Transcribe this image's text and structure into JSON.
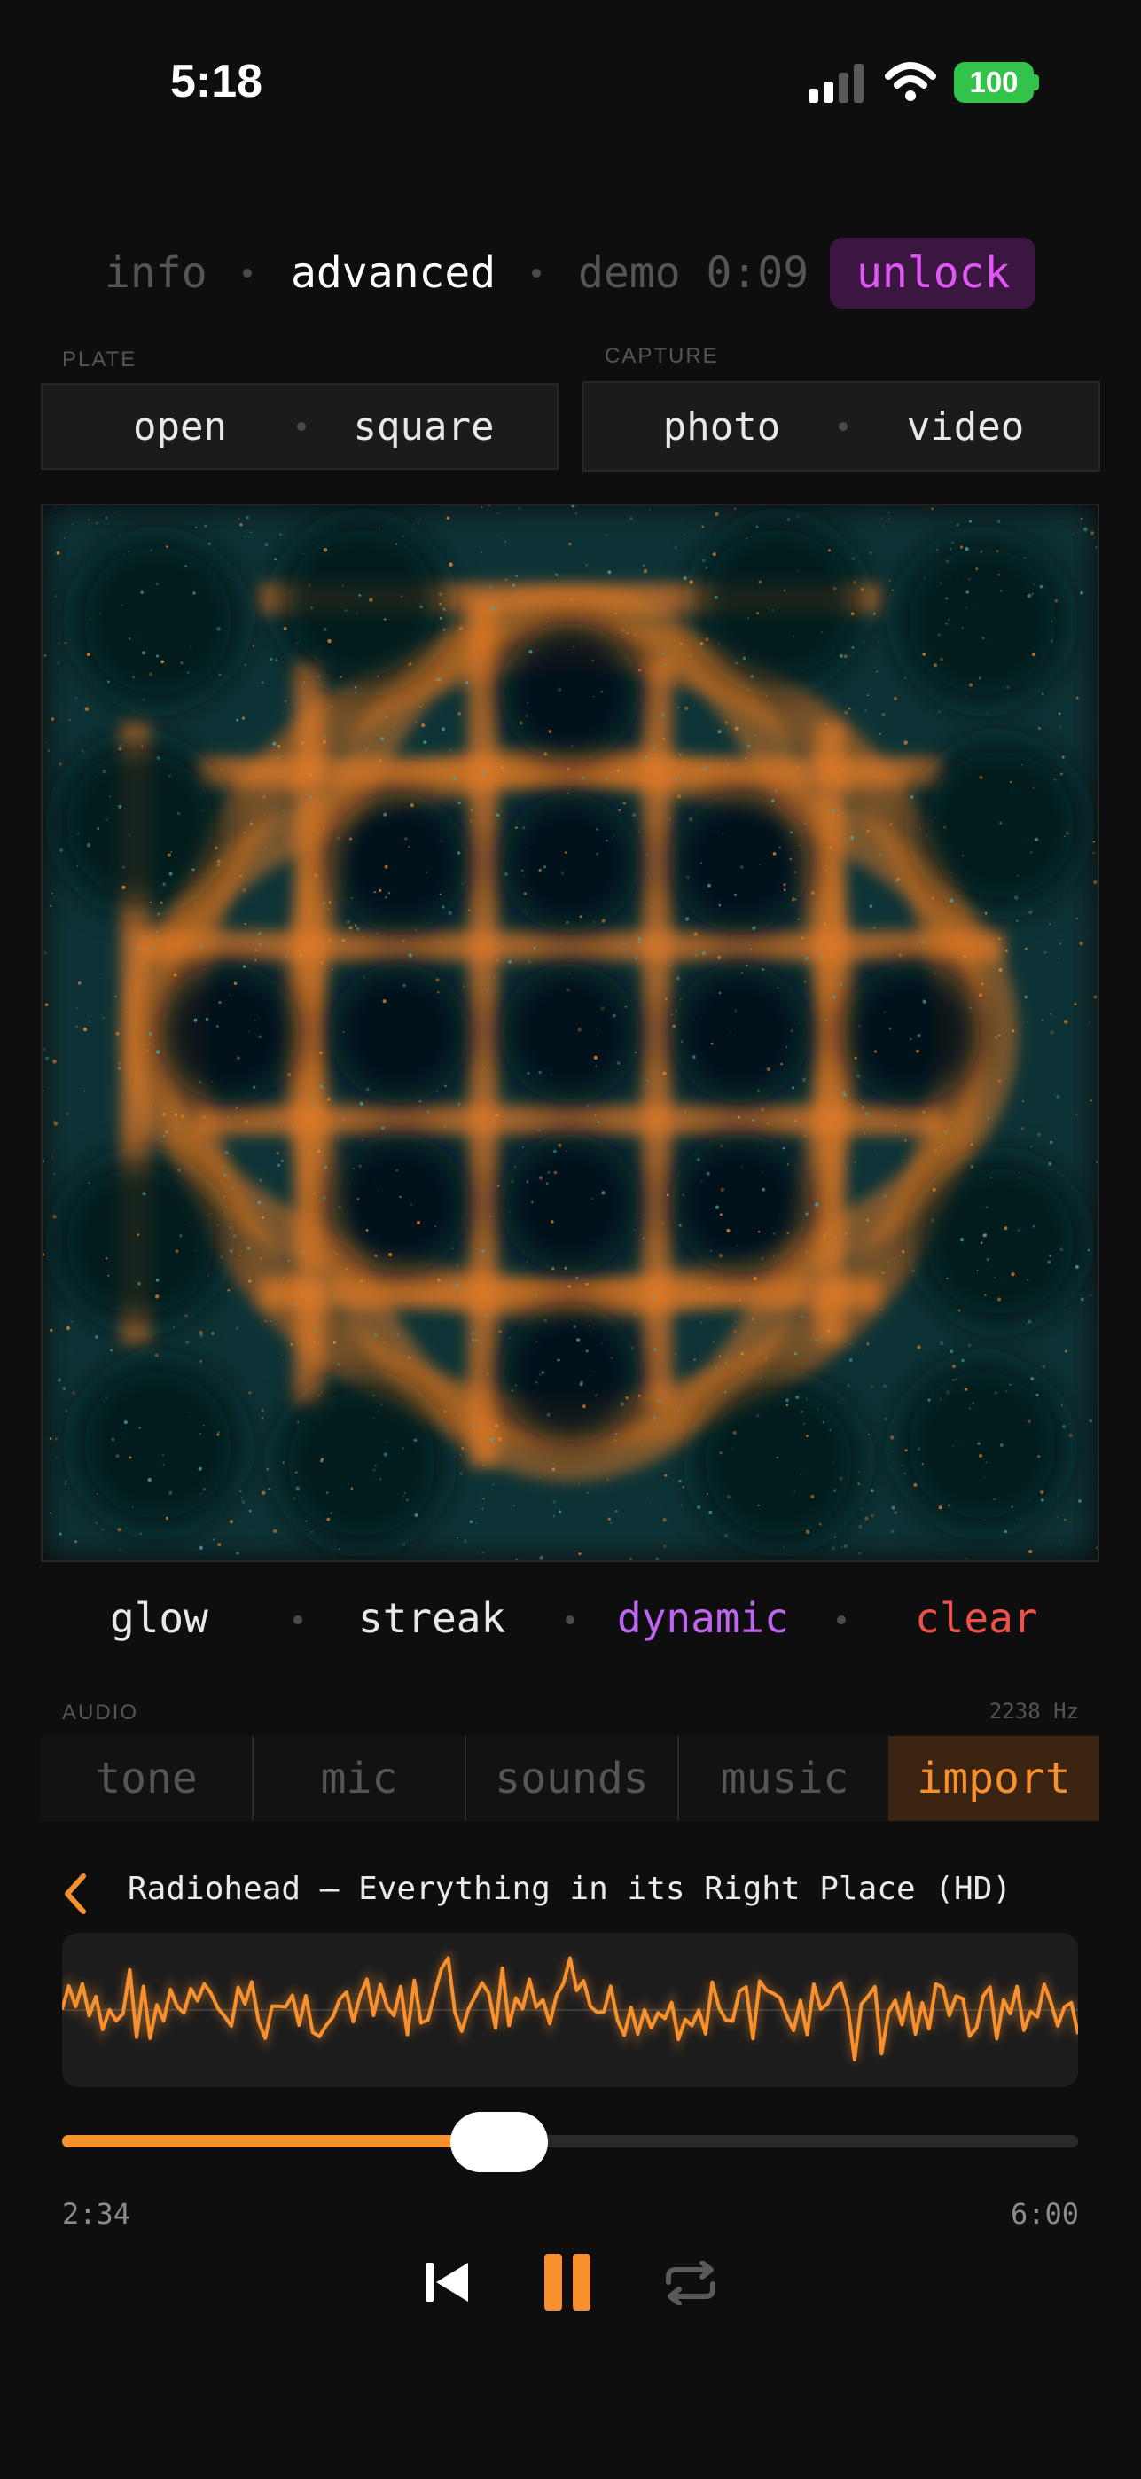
{
  "status_bar": {
    "time": "5:18",
    "battery": "100",
    "icons": [
      "cellular-signal-icon",
      "wifi-icon",
      "battery-icon"
    ]
  },
  "top_nav": {
    "info": "info",
    "advanced": "advanced",
    "demo": "demo 0:09",
    "unlock": "unlock"
  },
  "plate": {
    "label": "PLATE",
    "open": "open",
    "square": "square"
  },
  "capture": {
    "label": "CAPTURE",
    "photo": "photo",
    "video": "video"
  },
  "effects": {
    "glow": "glow",
    "streak": "streak",
    "dynamic": "dynamic",
    "clear": "clear"
  },
  "audio": {
    "label": "AUDIO",
    "frequency": "2238 Hz",
    "tabs": [
      "tone",
      "mic",
      "sounds",
      "music",
      "import"
    ],
    "selected_tab": "import"
  },
  "player": {
    "track": "Radiohead – Everything in its Right Place (HD)",
    "elapsed": "2:34",
    "duration": "6:00",
    "progress": 0.43,
    "icons": [
      "back-chevron-icon",
      "skip-back-icon",
      "pause-icon",
      "repeat-icon"
    ]
  },
  "colors": {
    "accent_orange": "#f7902f",
    "accent_purple": "#c064f2",
    "unlock_purple": "#e157f5",
    "clear_red": "#f0504a",
    "particle_teal": "#3b8d91"
  }
}
